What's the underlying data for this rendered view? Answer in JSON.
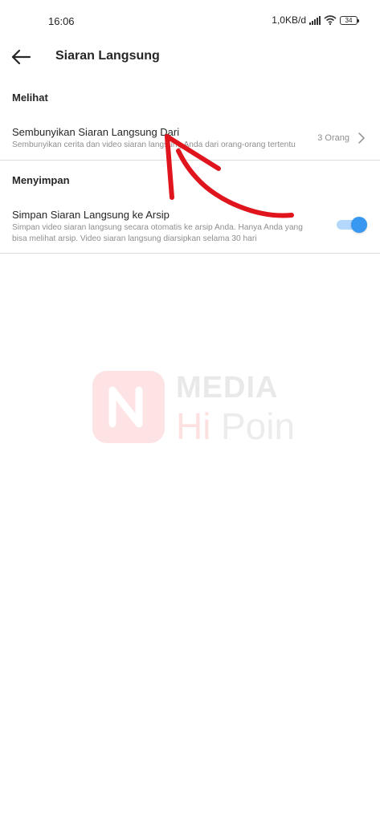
{
  "status_bar": {
    "time": "16:06",
    "network_speed": "1,0KB/d",
    "battery_level": "34"
  },
  "header": {
    "title": "Siaran Langsung",
    "back_icon": "arrow-left-icon"
  },
  "sections": {
    "viewing": {
      "header": "Melihat",
      "hide_live": {
        "title": "Sembunyikan Siaran Langsung Dari",
        "subtitle": "Sembunyikan cerita dan video siaran langsung Anda dari orang-orang tertentu",
        "value": "3 Orang"
      }
    },
    "saving": {
      "header": "Menyimpan",
      "archive": {
        "title": "Simpan Siaran Langsung ke Arsip",
        "subtitle_line1": "Simpan video siaran langsung secara otomatis ke arsip Anda. Hanya Anda yang",
        "subtitle_line2": "bisa melihat arsip. Video siaran langsung diarsipkan selama 30 hari",
        "enabled": true
      }
    }
  },
  "watermark": {
    "line1": "MEDIA",
    "line2_hi": "Hi",
    "line2_poin": "Poin"
  },
  "colors": {
    "accent": "#3897f0",
    "toggle_track": "#b3d8fb",
    "annotation": "#e0141c",
    "divider": "#dbdbdb",
    "secondary_text": "#8e8e8e"
  }
}
